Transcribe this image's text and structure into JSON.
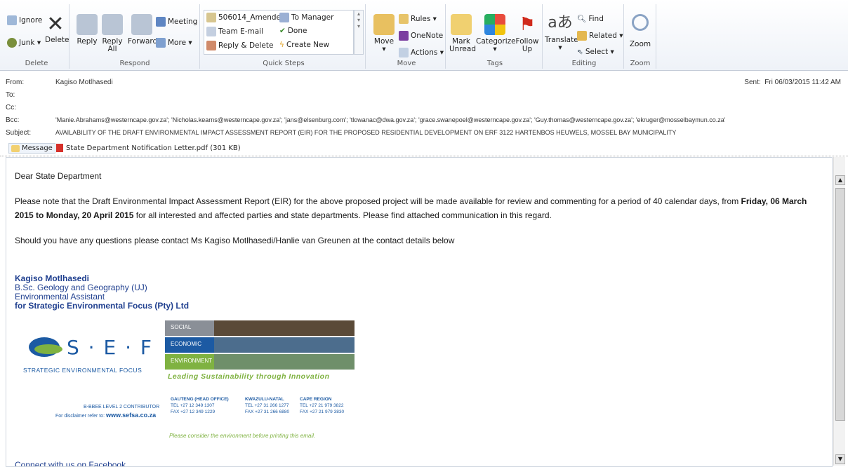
{
  "ribbon": {
    "delete": {
      "ignore": "Ignore",
      "junk": "Junk",
      "delete": "Delete",
      "label": "Delete"
    },
    "respond": {
      "reply": "Reply",
      "reply_all": "Reply All",
      "forward": "Forward",
      "meeting": "Meeting",
      "more": "More",
      "label": "Respond"
    },
    "quick_steps": {
      "item1": "506014_Amende...",
      "item2": "Team E-mail",
      "item3": "Reply & Delete",
      "item4": "To Manager",
      "item5": "Done",
      "item6": "Create New",
      "label": "Quick Steps"
    },
    "move": {
      "move": "Move",
      "rules": "Rules",
      "onenote": "OneNote",
      "actions": "Actions",
      "label": "Move"
    },
    "tags": {
      "mark_unread": "Mark Unread",
      "categorize": "Categorize",
      "follow_up": "Follow Up",
      "label": "Tags"
    },
    "editing": {
      "translate": "Translate",
      "find": "Find",
      "related": "Related",
      "select": "Select",
      "label": "Editing"
    },
    "zoom": {
      "zoom": "Zoom",
      "label": "Zoom"
    }
  },
  "header": {
    "from_label": "From:",
    "from": "Kagiso Motlhasedi",
    "sent_label": "Sent:",
    "sent": "Fri 06/03/2015 11:42 AM",
    "to_label": "To:",
    "cc_label": "Cc:",
    "bcc_label": "Bcc:",
    "bcc": "'Manie.Abrahams@westerncape.gov.za'; 'Nicholas.kearns@westerncape.gov.za'; 'jans@elsenburg.com'; 'tlowanac@dwa.gov.za'; 'grace.swanepoel@westerncape.gov.za'; 'Guy.thomas@westerncape.gov.za'; 'ekruger@mosselbaymun.co.za'",
    "subject_label": "Subject:",
    "subject": "AVAILABILITY OF THE DRAFT ENVIRONMENTAL IMPACT ASSESSMENT REPORT (EIR) FOR THE PROPOSED RESIDENTIAL DEVELOPMENT ON ERF 3122 HARTENBOS HEUWELS, MOSSEL BAY MUNICIPALITY"
  },
  "attachments": {
    "message_tab": "Message",
    "file": "State Department Notification Letter.pdf (301 KB)"
  },
  "email": {
    "greeting": "Dear State Department",
    "para1_a": "Please note that the Draft Environmental Impact Assessment Report (EIR) for the above proposed project will be made available for review and commenting for a period of  40 calendar days, from ",
    "para1_bold1": "Friday, 06 March 2015 to Monday, 20 April 2015",
    "para1_b": " for all interested and affected parties and state departments. Please find attached communication in this regard.",
    "para2": "Should you have any questions please contact Ms Kagiso Motlhasedi/Hanlie van Greunen at the contact details below",
    "sig_name": "Kagiso Motlhasedi",
    "sig_degree": "B.Sc. Geology and Geography (UJ)",
    "sig_role": "Environmental Assistant",
    "sig_company": "for Strategic Environmental Focus (Pty) Ltd",
    "facebook": "Connect with us on Facebook"
  },
  "logo": {
    "brand": "S · E · F",
    "brand_sub": "STRATEGIC ENVIRONMENTAL FOCUS",
    "social": "SOCIAL",
    "economic": "ECONOMIC",
    "environment": "ENVIRONMENT",
    "tagline": "Leading Sustainability through Innovation",
    "bbbee": "B-BBEE LEVEL 2 CONTRIBUTOR",
    "disclaimer": "For disclaimer refer to: ",
    "website": "www.sefsa.co.za",
    "gauteng_title": "GAUTENG (HEAD OFFICE)",
    "gauteng_tel": "TEL +27 12 349 1307",
    "gauteng_fax": "FAX +27 12 349 1229",
    "kzn_title": "KWAZULU-NATAL",
    "kzn_tel": "TEL +27 31 266 1277",
    "kzn_fax": "FAX +27 31 266 6880",
    "cape_title": "CAPE REGION",
    "cape_tel": "TEL +27 21 979 3822",
    "cape_fax": "FAX +27 21 979 3830",
    "print_note": "Please consider the environment before printing this email."
  },
  "colors": {
    "accent": "#1f3f8f",
    "sef_green": "#7fb241",
    "sef_blue": "#1c5aa3"
  }
}
